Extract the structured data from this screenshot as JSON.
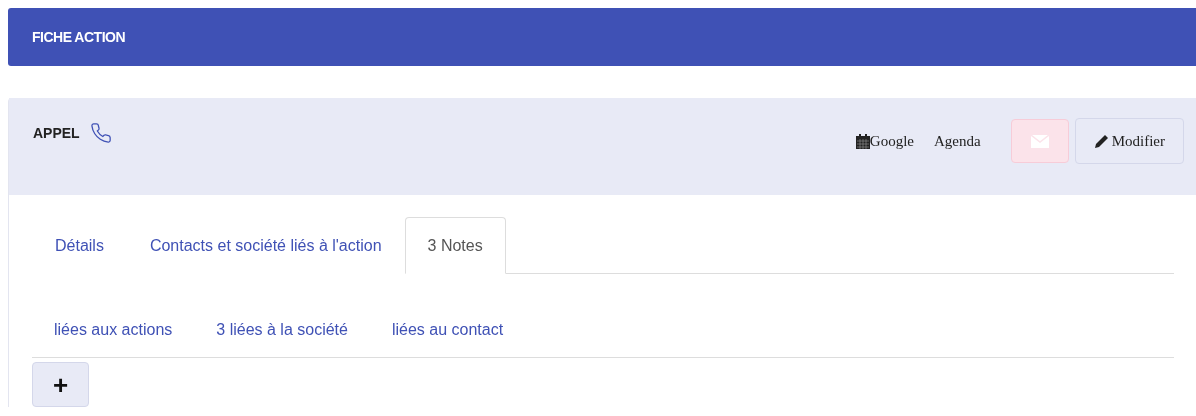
{
  "header": {
    "title": "FICHE ACTION"
  },
  "action": {
    "title": "APPEL",
    "links": [
      "Google",
      "Agenda"
    ],
    "edit_button": "Modifier"
  },
  "tabs": [
    {
      "label": "Détails",
      "selected": false
    },
    {
      "label": "Contacts et société liés à l'action",
      "selected": false
    },
    {
      "label": "3 Notes",
      "selected": true
    }
  ],
  "subtabs": [
    {
      "label": "liées aux actions",
      "selected": false
    },
    {
      "label": "3 liées à la société",
      "selected": false
    },
    {
      "label": "liées au contact",
      "selected": false
    }
  ],
  "add_button": "+"
}
